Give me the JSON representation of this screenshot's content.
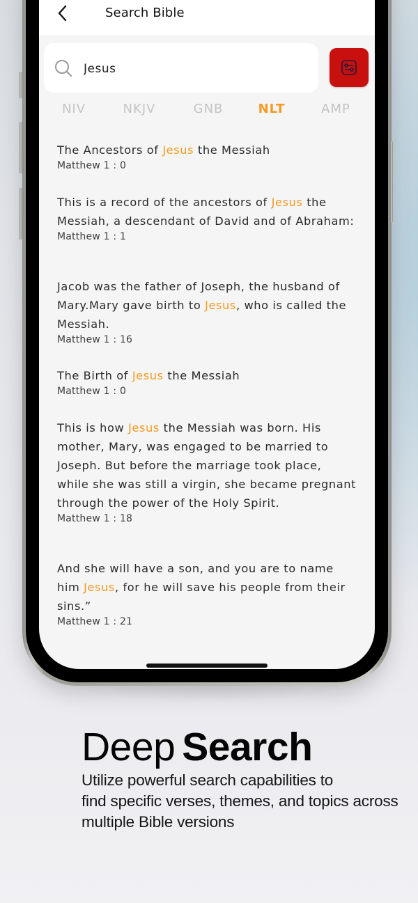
{
  "header": {
    "title": "Search Bible",
    "back_icon": "chevron-left-icon"
  },
  "search": {
    "value": "Jesus",
    "placeholder": "Search",
    "icon": "search-icon",
    "filter_icon": "sliders-icon"
  },
  "versions": {
    "items": [
      "NIV",
      "NKJV",
      "GNB",
      "NLT",
      "AMP"
    ],
    "active": "NLT"
  },
  "results": [
    {
      "before": "The Ancestors of ",
      "highlight": "Jesus",
      "after": " the Messiah",
      "reference": "Matthew 1 : 0"
    },
    {
      "before": "This is a record of the ancestors of ",
      "highlight": "Jesus",
      "after": " the Messiah, a descendant of David and of Abraham:",
      "reference": "Matthew 1 : 1"
    },
    {
      "before": "Jacob was the father of Joseph, the husband of Mary.Mary gave birth to ",
      "highlight": "Jesus",
      "after": ", who is called the Messiah.",
      "reference": "Matthew 1 : 16"
    },
    {
      "before": "The Birth of ",
      "highlight": "Jesus",
      "after": " the Messiah",
      "reference": "Matthew 1 : 0"
    },
    {
      "before": "This is how ",
      "highlight": "Jesus",
      "after": " the Messiah was born. His mother, Mary, was engaged to be married to Joseph. But before the marriage took place, while she was still a virgin, she became pregnant through the power of the Holy Spirit.",
      "reference": "Matthew 1 : 18"
    },
    {
      "before": "And she will have a son, and you are to name him ",
      "highlight": "Jesus",
      "after": ", for he will save his people from their sins.”",
      "reference": "Matthew 1 : 21"
    }
  ],
  "promo": {
    "title_light": "Deep",
    "title_bold": "Search",
    "description_lines": [
      "Utilize powerful search capabilities to",
      "find specific verses, themes, and topics across",
      "multiple Bible versions"
    ]
  },
  "colors": {
    "accent": "#f59a22",
    "filter_button": "#c8100f",
    "inactive_tab": "#c4c4c4"
  }
}
